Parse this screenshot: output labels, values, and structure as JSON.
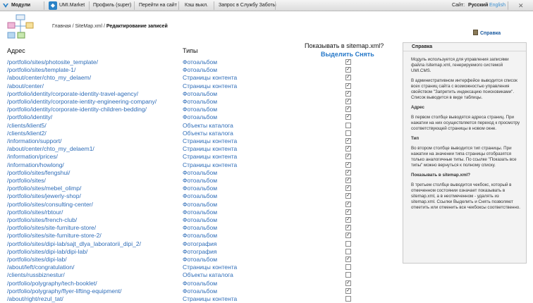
{
  "topbar": {
    "modules": "Модули",
    "market": "UMI.Market",
    "profile": "Профиль (super)",
    "goto_site": "Перейти на сайт",
    "cache": "Кэш выкл.",
    "support": "Запрос в Службу Заботы",
    "site_label": "Сайт:",
    "lang_ru": "Русский",
    "lang_en": "English"
  },
  "breadcrumb": {
    "home": "Главная",
    "sep": " / ",
    "module": "SiteMap.xml",
    "current": "Редактирование записей"
  },
  "help_link": "Справка",
  "table": {
    "col_address": "Адрес",
    "col_types": "Типы",
    "col_show": "Показывать в sitemap.xml?",
    "select_label": "Выделить",
    "clear_label": "Снять",
    "rows": [
      {
        "url": "/portfolio/sites/photosite_template/",
        "type": "Фотоальбом",
        "checked": true
      },
      {
        "url": "/portfolio/sites/template-1/",
        "type": "Фотоальбом",
        "checked": true
      },
      {
        "url": "/about/center/chto_my_delaem/",
        "type": "Страницы контента",
        "checked": true
      },
      {
        "url": "/about/center/",
        "type": "Страницы контента",
        "checked": true
      },
      {
        "url": "/portfolio/identity/corporate-identity-travel-agency/",
        "type": "Фотоальбом",
        "checked": true
      },
      {
        "url": "/portfolio/identity/corporate-ientity-engineering-company/",
        "type": "Фотоальбом",
        "checked": true
      },
      {
        "url": "/portfolio/identity/corporate-identity-children-bedding/",
        "type": "Фотоальбом",
        "checked": true
      },
      {
        "url": "/portfolio/identity/",
        "type": "Фотоальбом",
        "checked": true
      },
      {
        "url": "/clients/klient5/",
        "type": "Объекты каталога",
        "checked": false
      },
      {
        "url": "/clients/klient2/",
        "type": "Объекты каталога",
        "checked": false
      },
      {
        "url": "/information/support/",
        "type": "Страницы контента",
        "checked": true
      },
      {
        "url": "/about/center/chto_my_delaem1/",
        "type": "Страницы контента",
        "checked": true
      },
      {
        "url": "/information/prices/",
        "type": "Страницы контента",
        "checked": true
      },
      {
        "url": "/information/howlong/",
        "type": "Страницы контента",
        "checked": true
      },
      {
        "url": "/portfolio/sites/fengshui/",
        "type": "Фотоальбом",
        "checked": true
      },
      {
        "url": "/portfolio/sites/",
        "type": "Фотоальбом",
        "checked": true
      },
      {
        "url": "/portfolio/sites/mebel_olimp/",
        "type": "Фотоальбом",
        "checked": true
      },
      {
        "url": "/portfolio/sites/jewerly-shop/",
        "type": "Фотоальбом",
        "checked": true
      },
      {
        "url": "/portfolio/sites/consulting-center/",
        "type": "Фотоальбом",
        "checked": true
      },
      {
        "url": "/portfolio/sites/rbtour/",
        "type": "Фотоальбом",
        "checked": true
      },
      {
        "url": "/portfolio/sites/french-club/",
        "type": "Фотоальбом",
        "checked": true
      },
      {
        "url": "/portfolio/sites/site-furniture-store/",
        "type": "Фотоальбом",
        "checked": true
      },
      {
        "url": "/portfolio/sites/site-furniture-store-2/",
        "type": "Фотоальбом",
        "checked": true
      },
      {
        "url": "/portfolio/sites/dipi-lab/sajt_dlya_laboratorii_dipi_2/",
        "type": "Фотография",
        "checked": false
      },
      {
        "url": "/portfolio/sites/dipi-lab/dipi-lab/",
        "type": "Фотография",
        "checked": false
      },
      {
        "url": "/portfolio/sites/dipi-lab/",
        "type": "Фотоальбом",
        "checked": true
      },
      {
        "url": "/about/left/congratulation/",
        "type": "Страницы контента",
        "checked": false
      },
      {
        "url": "/clients/russbiznestur/",
        "type": "Объекты каталога",
        "checked": false
      },
      {
        "url": "/portfolio/polygraphy/tech-booklet/",
        "type": "Фотоальбом",
        "checked": true
      },
      {
        "url": "/portfolio/polygraphy/flyer-lifting-equipment/",
        "type": "Фотоальбом",
        "checked": true
      },
      {
        "url": "/about/right/rezul_tat/",
        "type": "Страницы контента",
        "checked": false
      }
    ]
  },
  "sidebar": {
    "title": "Справка",
    "p1": "Модуль используется для управления записями файла /sitemap.xml, генерируемого системой UMI.CMS.",
    "p2": "В административном интерфейсе выводится список всех страниц сайта с возможностью управления свойством \"Запретить индексацию поисковиками\". Список выводится в виде таблицы.",
    "h1": "Адрес",
    "p3": "В первом столбце выводятся адреса страниц. При нажатии на них осуществляется переход к просмотру соответствующей страницы в новом окне.",
    "h2": "Тип",
    "p4": "Во втором столбце выводится тип страницы. При нажатии на значении типа страницы отобразятся только аналогичные типы. По ссылке \"Показать все типы\" можно вернуться к полному списку.",
    "h3": "Показывать в sitemap.xml?",
    "p5": "В третьем столбце выводится чекбокс, который в отмеченном состоянии означает показывать в sitemap.xml, а в неотмеченном - удалять из sitemap.xml. Ссылки Выделить и Снять позволяют отметить или отменить все чекбоксы соответственно."
  }
}
